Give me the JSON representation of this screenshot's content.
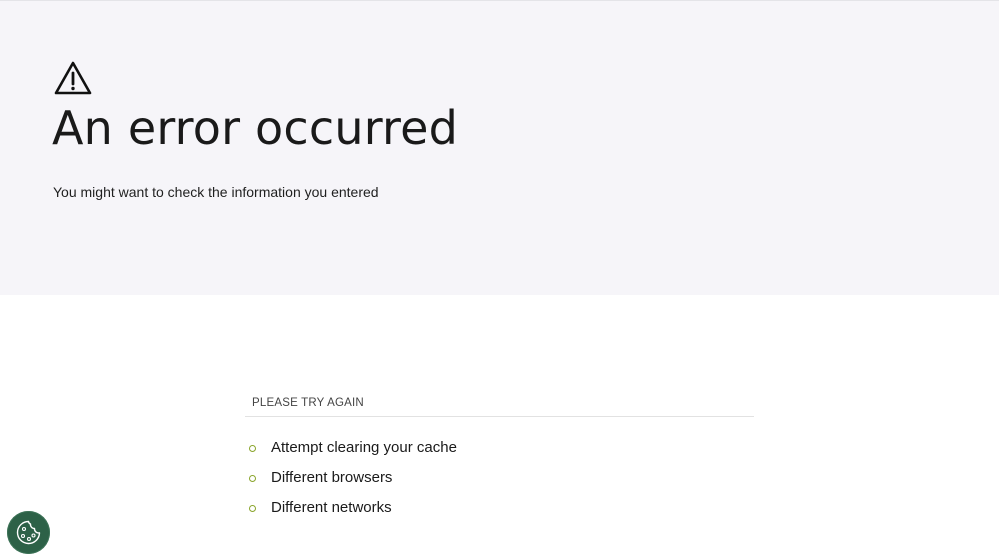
{
  "error": {
    "title": "An error occurred",
    "message": "You might want to check the information you entered",
    "icon": "warning-triangle-icon"
  },
  "retry": {
    "heading": "PLEASE TRY AGAIN",
    "tips": [
      "Attempt clearing your cache",
      "Different browsers",
      "Different networks"
    ]
  },
  "cookie_button": {
    "icon": "cookie-icon"
  },
  "colors": {
    "hero_background": "#f6f5f9",
    "bullet": "#8aa52c",
    "cookie_button": "#2d6147"
  }
}
